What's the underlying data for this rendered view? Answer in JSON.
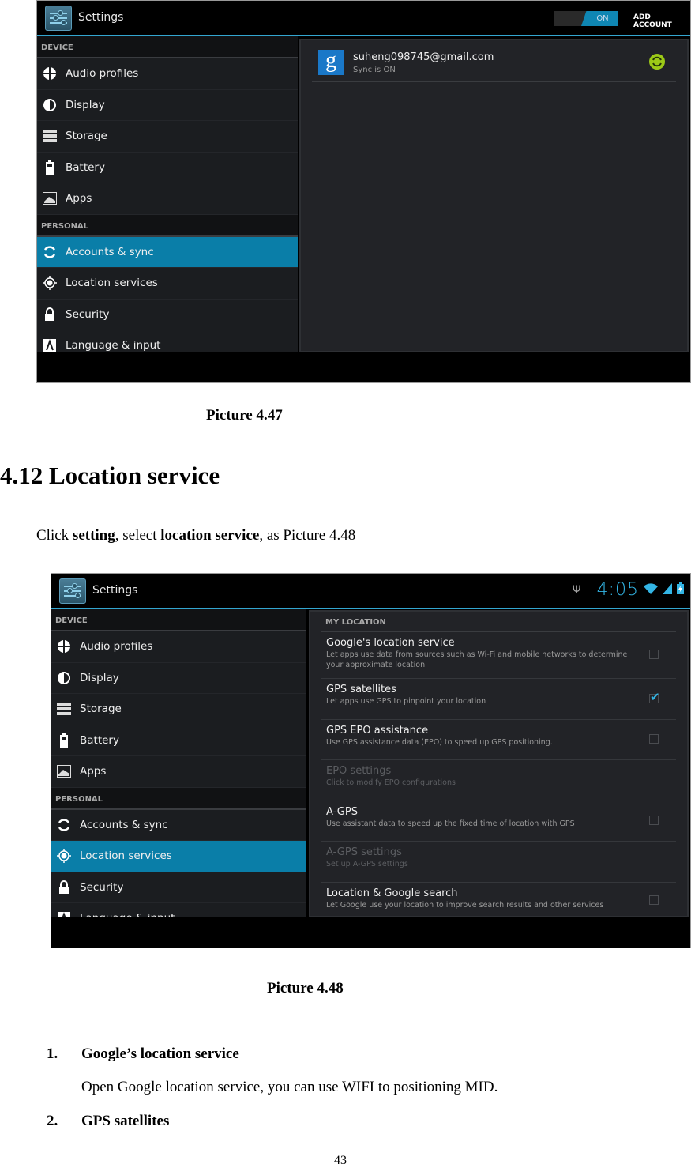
{
  "picture_1": {
    "app_title": "Settings",
    "toggle_label": "ON",
    "add_account_label": "ADD ACCOUNT",
    "sidebar": {
      "device_header": "DEVICE",
      "personal_header": "PERSONAL",
      "device_items": [
        {
          "label": "Audio profiles",
          "icon": "audio-profiles-icon"
        },
        {
          "label": "Display",
          "icon": "display-icon"
        },
        {
          "label": "Storage",
          "icon": "storage-icon"
        },
        {
          "label": "Battery",
          "icon": "battery-icon"
        },
        {
          "label": "Apps",
          "icon": "apps-icon"
        }
      ],
      "personal_items": [
        {
          "label": "Accounts & sync",
          "icon": "sync-icon",
          "selected": true
        },
        {
          "label": "Location services",
          "icon": "location-icon",
          "selected": false
        },
        {
          "label": "Security",
          "icon": "lock-icon",
          "selected": false
        },
        {
          "label": "Language & input",
          "icon": "language-icon",
          "selected": false
        }
      ]
    },
    "account": {
      "email": "suheng098745@gmail.com",
      "status": "Sync is ON",
      "logo_letter": "g"
    }
  },
  "caption_1": "Picture 4.47",
  "section_heading": "4.12 Location service",
  "intro": {
    "t1": "Click ",
    "b1": "setting",
    "t2": ", select ",
    "b2": "location service",
    "t3": ", as Picture 4.48"
  },
  "picture_2": {
    "app_title": "Settings",
    "status_bar": {
      "time": "4:05",
      "icons": [
        "usb-icon",
        "wifi-icon",
        "signal-icon",
        "battery-charging-icon"
      ]
    },
    "sidebar": {
      "device_header": "DEVICE",
      "personal_header": "PERSONAL",
      "device_items": [
        {
          "label": "Audio profiles"
        },
        {
          "label": "Display"
        },
        {
          "label": "Storage"
        },
        {
          "label": "Battery"
        },
        {
          "label": "Apps"
        }
      ],
      "personal_items": [
        {
          "label": "Accounts & sync",
          "selected": false
        },
        {
          "label": "Location services",
          "selected": true
        },
        {
          "label": "Security",
          "selected": false
        },
        {
          "label": "Language & input",
          "selected": false
        }
      ]
    },
    "content": {
      "header": "MY LOCATION",
      "prefs": [
        {
          "title": "Google's location service",
          "summary": "Let apps use data from sources such as Wi-Fi and mobile networks to determine your approximate location",
          "checkbox": true,
          "checked": false,
          "enabled": true
        },
        {
          "title": "GPS satellites",
          "summary": "Let apps use GPS to pinpoint your location",
          "checkbox": true,
          "checked": true,
          "enabled": true
        },
        {
          "title": "GPS EPO assistance",
          "summary": "Use GPS assistance data (EPO) to speed up GPS positioning.",
          "checkbox": true,
          "checked": false,
          "enabled": true
        },
        {
          "title": "EPO settings",
          "summary": "Click to modify EPO configurations",
          "checkbox": false,
          "checked": false,
          "enabled": false
        },
        {
          "title": "A-GPS",
          "summary": "Use assistant data to speed up the fixed time of location with GPS",
          "checkbox": true,
          "checked": false,
          "enabled": true
        },
        {
          "title": "A-GPS settings",
          "summary": "Set up A-GPS settings",
          "checkbox": false,
          "checked": false,
          "enabled": false
        },
        {
          "title": "Location & Google search",
          "summary": "Let Google use your location to improve search results and other services",
          "checkbox": true,
          "checked": false,
          "enabled": true
        }
      ]
    }
  },
  "caption_2": "Picture 4.48",
  "list": [
    {
      "num": "1.",
      "title": "Google’s location service",
      "body": "Open Google location service, you can use WIFI to positioning MID."
    },
    {
      "num": "2.",
      "title": "GPS satellites"
    }
  ],
  "page_number": "43",
  "colors": {
    "accent": "#33b5e5",
    "selected": "#0a7ea8",
    "sync_green": "#9cc917",
    "google_blue": "#1a78c8"
  }
}
